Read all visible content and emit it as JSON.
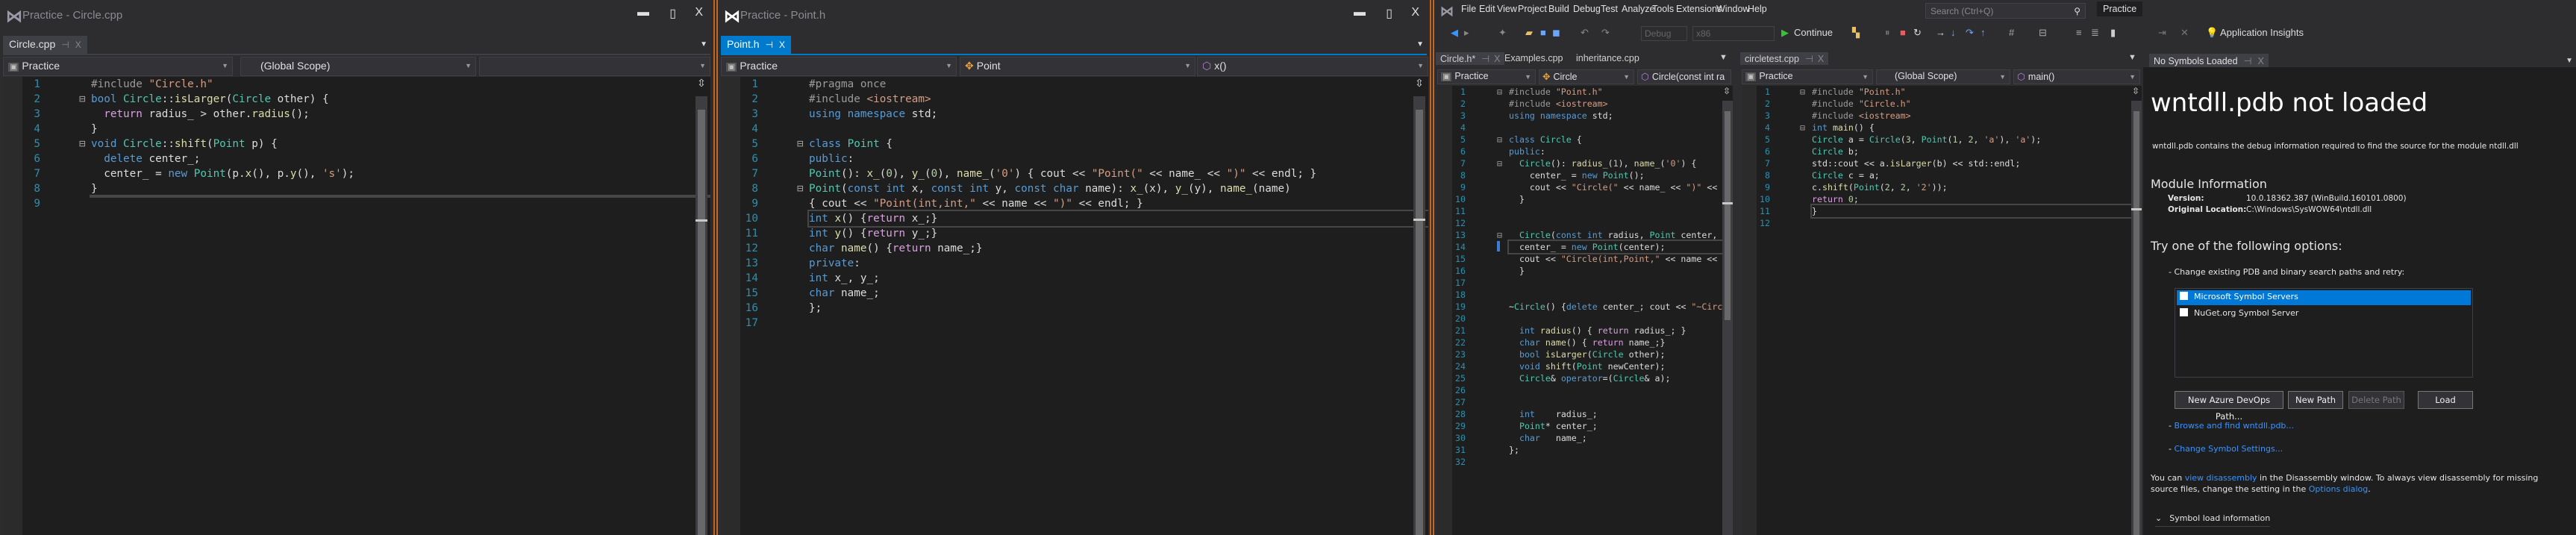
{
  "window1": {
    "title": "Practice - Circle.cpp",
    "controls": {
      "minimize": "▬",
      "maximize": "▯",
      "close": "X"
    },
    "tab": {
      "label": "Circle.cpp",
      "pin": "⊣",
      "close": "X"
    },
    "nav": {
      "project": "Practice",
      "scope": "(Global Scope)",
      "member": ""
    },
    "current_line": 9,
    "folds": [
      2,
      5
    ],
    "lines": [
      "#include \"Circle.h\"",
      "bool Circle::isLarger(Circle other) {",
      "  return radius_ > other.radius();",
      "}",
      "void Circle::shift(Point p) {",
      "  delete center_;",
      "  center_ = new Point(p.x(), p.y(), 's');",
      "}",
      ""
    ]
  },
  "window2": {
    "title": "Practice - Point.h",
    "controls": {
      "minimize": "▬",
      "maximize": "▯",
      "close": "X"
    },
    "tab": {
      "label": "Point.h",
      "pin": "⊣",
      "close": "X"
    },
    "nav": {
      "project": "Practice",
      "scope": "Point",
      "member": "x()"
    },
    "current_line": 10,
    "folds": [
      5,
      8
    ],
    "lines": [
      "#pragma once",
      "#include <iostream>",
      "using namespace std;",
      "",
      "class Point {",
      "public:",
      "Point(): x_(0), y_(0), name_('0') { cout << \"Point(\" << name_ << \")\" << endl; }",
      "Point(const int x, const int y, const char name): x_(x), y_(y), name_(name)",
      "{ cout << \"Point(int,int,\" << name << \")\" << endl; }",
      "int x() {return x_;}",
      "int y() {return y_;}",
      "char name() {return name_;}",
      "private:",
      "int x_, y_;",
      "char name_;",
      "};",
      ""
    ]
  },
  "window3": {
    "menu": [
      "File",
      "Edit",
      "View",
      "Project",
      "Build",
      "Debug",
      "Test",
      "Analyze",
      "Tools",
      "Extensions",
      "Window",
      "Help"
    ],
    "search_placeholder": "Search (Ctrl+Q)",
    "solution_name": "Practice",
    "toolbar": {
      "config": "Debug",
      "platform": "x86",
      "continue": "Continue",
      "app_insights": "Application Insights"
    },
    "left_pane": {
      "tabs": [
        {
          "label": "Circle.h*",
          "pin": "⊣",
          "close": "X"
        },
        {
          "label": "Examples.cpp"
        },
        {
          "label": "inheritance.cpp"
        }
      ],
      "nav": {
        "project": "Practice",
        "scope": "Circle",
        "member": "Circle(const int ra"
      },
      "current_line": 14,
      "folds": [
        1,
        5,
        7,
        13
      ],
      "lines": [
        "#include \"Point.h\"",
        "#include <iostream>",
        "using namespace std;",
        "",
        "class Circle {",
        "public:",
        "  Circle(): radius_(1), name_('0') {",
        "    center_ = new Point();",
        "    cout << \"Circle(\" << name_ << \")\" <<",
        "  }",
        "",
        "",
        "  Circle(const int radius, Point center,",
        "  center_ = new Point(center);",
        "  cout << \"Circle(int,Point,\" << name <<",
        "  }",
        "",
        "",
        "~Circle() {delete center_; cout << \"~Circ",
        "",
        "  int radius() { return radius_; }",
        "  char name() { return name_;}",
        "  bool isLarger(Circle other);",
        "  void shift(Point newCenter);",
        "  Circle& operator=(Circle& a);",
        "",
        "",
        "  int    radius_;",
        "  Point* center_;",
        "  char   name_;",
        "};",
        ""
      ]
    },
    "right_pane": {
      "tabs": [
        {
          "label": "circletest.cpp",
          "pin": "⊣",
          "close": "X"
        }
      ],
      "nav": {
        "project": "Practice",
        "scope": "(Global Scope)",
        "member": "main()"
      },
      "current_line": 11,
      "folds": [
        1,
        4
      ],
      "lines": [
        "#include \"Point.h\"",
        "#include \"Circle.h\"",
        "#include <iostream>",
        "int main() {",
        "Circle a = Circle(3, Point(1, 2, 'a'), 'a');",
        "Circle b;",
        "std::cout << a.isLarger(b) << std::endl;",
        "Circle c = a;",
        "c.shift(Point(2, 2, '2'));",
        "return 0;",
        "}",
        ""
      ]
    },
    "symbols": {
      "tab": {
        "label": "No Symbols Loaded",
        "pin": "⊣",
        "close": "X"
      },
      "heading": "wntdll.pdb not loaded",
      "description": "wntdll.pdb contains the debug information required to find the source for the module ntdll.dll",
      "module_heading": "Module Information",
      "version_label": "Version:",
      "version_value": "10.0.18362.387 (WinBuild.160101.0800)",
      "location_label": "Original Location:",
      "location_value": "C:\\Windows\\SysWOW64\\ntdll.dll",
      "options_heading": "Try one of the following options:",
      "change_paths": "Change existing PDB and binary search paths and retry:",
      "servers": [
        {
          "label": "Microsoft Symbol Servers",
          "checked": false,
          "selected": true
        },
        {
          "label": "NuGet.org Symbol Server",
          "checked": false,
          "selected": false
        }
      ],
      "buttons": {
        "azure": "New Azure DevOps Path...",
        "new_path": "New Path",
        "delete_path": "Delete Path",
        "load": "Load"
      },
      "browse_link": "Browse and find wntdll.pdb...",
      "settings_link": "Change Symbol Settings...",
      "footer_1": "You can ",
      "footer_link_1": "view disassembly",
      "footer_2": " in the Disassembly window. To always view disassembly for missing source files, change the setting in the ",
      "footer_link_2": "Options dialog",
      "footer_3": ".",
      "load_info": "Symbol load information"
    }
  },
  "colors": {
    "accent": "#007acc",
    "window_border": "#c8641e",
    "editor_bg": "#1e1e1e",
    "chrome_bg": "#2d2d30"
  }
}
